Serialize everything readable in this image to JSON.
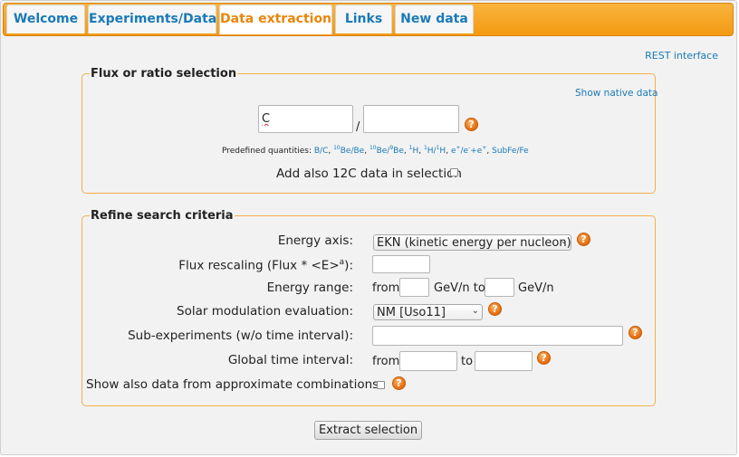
{
  "tabs": [
    {
      "label": "Welcome",
      "active": false
    },
    {
      "label": "Experiments/Data",
      "active": false
    },
    {
      "label": "Data extraction",
      "active": true
    },
    {
      "label": "Links",
      "active": false
    },
    {
      "label": "New data",
      "active": false
    }
  ],
  "rest_link": "REST interface",
  "flux_section": {
    "legend": "Flux or ratio selection",
    "show_native_link": "Show native data",
    "numerator_value": "C",
    "denominator_value": "",
    "separator": "/",
    "predefined_label": "Predefined quantities: ",
    "predefined": {
      "bc": "B/C",
      "be10be_sup": "10",
      "be10be_text": "Be/Be",
      "be10be9_sup1": "10",
      "be10be9_mid": "Be/",
      "be10be9_sup2": "9",
      "be10be9_end": "Be",
      "h1_sup": "1",
      "h1_text": "H",
      "h1h_sup": "1",
      "h1h_text": "H/",
      "h1h_sup2": "1",
      "h1h_end": "H",
      "positron": "e",
      "positron_sup": "+",
      "positron_mid": "/e",
      "positron_sup2": "-",
      "positron_end": "+e",
      "positron_sup3": "+",
      "subfefe": "SubFe/Fe"
    },
    "add12c_label": "Add also 12C data in selection"
  },
  "refine_section": {
    "legend": "Refine search criteria",
    "energy_axis_label": "Energy axis:",
    "energy_axis_value": "EKN (kinetic energy per nucleon)",
    "flux_rescaling_label_pre": "Flux rescaling (Flux * <E>",
    "flux_rescaling_sup": "a",
    "flux_rescaling_label_post": "):",
    "energy_range_label": "Energy range:",
    "from_text": "from",
    "gevn_to_text": "GeV/n to",
    "gevn_text": "GeV/n",
    "solar_mod_label": "Solar modulation evaluation:",
    "solar_mod_value": "NM [Uso11]",
    "subexp_label": "Sub-experiments (w/o time interval):",
    "time_interval_label": "Global time interval:",
    "time_from_text": "from",
    "time_to_text": "to",
    "approx_label": "Show also data from approximate combinations:"
  },
  "extract_button": "Extract selection",
  "help_glyph": "?",
  "dropdown_glyph": "⌄",
  "colors": {
    "tabbar": "#f6a31c",
    "link": "#1a7ab8",
    "active_tab_text": "#e8860c",
    "fieldset_border": "#f3b04a",
    "help_icon": "#e46b0b"
  }
}
